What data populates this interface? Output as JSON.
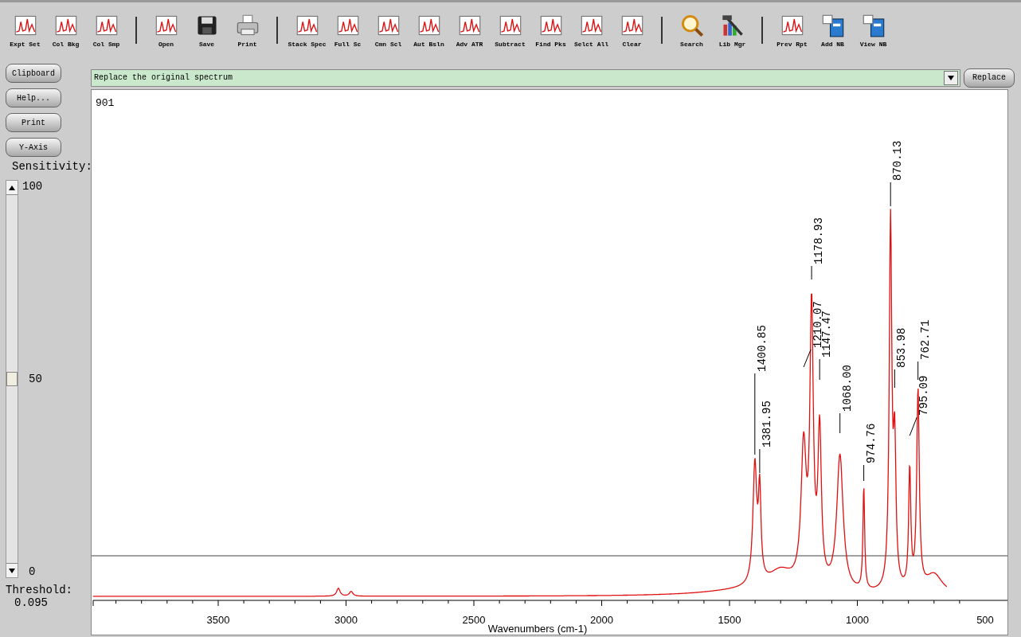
{
  "toolbar": {
    "groups": [
      [
        "Expt Set",
        "Col Bkg",
        "Col Smp"
      ],
      [
        "Open",
        "Save",
        "Print"
      ],
      [
        "Stack Spec",
        "Full Sc",
        "Cmn Scl",
        "Aut Bsln",
        "Adv ATR",
        "Subtract",
        "Find Pks",
        "Selct All",
        "Clear"
      ],
      [
        "Search",
        "Lib Mgr"
      ],
      [
        "Prev Rpt",
        "Add NB",
        "View NB"
      ]
    ]
  },
  "side_buttons": [
    "Clipboard",
    "Help...",
    "Print",
    "Y-Axis"
  ],
  "action_bar": {
    "value": "Replace the original spectrum",
    "button": "Replace"
  },
  "sensitivity": {
    "label": "Sensitivity:",
    "level": 0.5,
    "scale": [
      "100",
      "50",
      "0"
    ]
  },
  "threshold": {
    "label": "Threshold:",
    "value": "0.095"
  },
  "plot": {
    "title": "901",
    "peak_labels": [
      "1400.85",
      "1381.95",
      "1210.07",
      "1178.93",
      "1147.47",
      "1068.00",
      "974.76",
      "870.13",
      "853.98",
      "795.09",
      "762.71"
    ],
    "xticks": [
      "3500",
      "3000",
      "2500",
      "2000",
      "1500",
      "1000",
      "500"
    ],
    "xlabel": "Wavenumbers (cm-1)"
  }
}
